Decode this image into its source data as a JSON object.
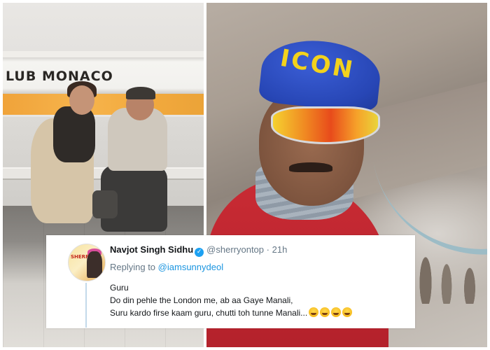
{
  "left_photo": {
    "storefront_sign": "LUB MONACO"
  },
  "right_photo": {
    "cap_text": "ICON"
  },
  "tweet": {
    "display_name": "Navjot Singh Sidhu",
    "handle": "@sherryontop",
    "separator": "·",
    "time": "21h",
    "replying_prefix": "Replying to",
    "replying_to": "@iamsunnydeol",
    "lines": [
      "Guru",
      "Do din pehle the London me, ab aa Gaye Manali,",
      "Suru kardo firse kaam guru, chutti toh tunne Manali..."
    ],
    "emoji_count": 4,
    "emoji_name": "rolling-on-the-floor-laughing",
    "verified_icon": "verified-badge-icon",
    "colors": {
      "link": "#1b95e0",
      "verified": "#1da1f2",
      "secondary_text": "#657786"
    }
  },
  "avatar": {
    "badge_text": "SHERRY"
  }
}
